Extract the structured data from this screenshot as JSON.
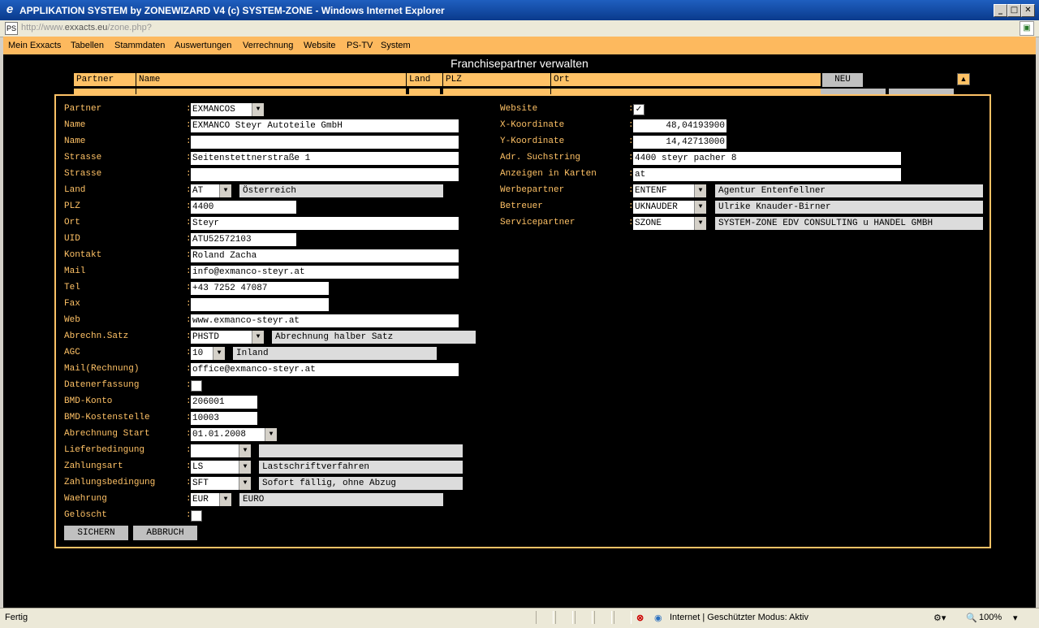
{
  "window": {
    "title": "APPLIKATION SYSTEM by ZONEWIZARD V4 (c) SYSTEM-ZONE - Windows Internet Explorer",
    "url_prefix": "http://www.",
    "url_domain": "exxacts.eu",
    "url_path": "/zone.php?"
  },
  "menu": [
    "Mein Exxacts",
    "Tabellen",
    "Stammdaten",
    "Auswertungen",
    "Verrechnung",
    "Website",
    "PS-TV",
    "System"
  ],
  "page_title": "Franchisepartner verwalten",
  "list_header": {
    "partner": "Partner",
    "name": "Name",
    "land": "Land",
    "plz": "PLZ",
    "ort": "Ort",
    "new_button": "NEU"
  },
  "form_left": {
    "partner": {
      "label": "Partner",
      "value": "EXMANCOS"
    },
    "name1": {
      "label": "Name",
      "value": "EXMANCO Steyr Autoteile GmbH"
    },
    "name2": {
      "label": "Name",
      "value": ""
    },
    "strasse1": {
      "label": "Strasse",
      "value": "Seitenstettnerstraße 1"
    },
    "strasse2": {
      "label": "Strasse",
      "value": ""
    },
    "land": {
      "label": "Land",
      "value": "AT",
      "desc": "Österreich"
    },
    "plz": {
      "label": "PLZ",
      "value": "4400"
    },
    "ort": {
      "label": "Ort",
      "value": "Steyr"
    },
    "uid": {
      "label": "UID",
      "value": "ATU52572103"
    },
    "kontakt": {
      "label": "Kontakt",
      "value": "Roland Zacha"
    },
    "mail": {
      "label": "Mail",
      "value": "info@exmanco-steyr.at"
    },
    "tel": {
      "label": "Tel",
      "value": "+43 7252 47087"
    },
    "fax": {
      "label": "Fax",
      "value": ""
    },
    "web": {
      "label": "Web",
      "value": "www.exmanco-steyr.at"
    },
    "abrechn_satz": {
      "label": "Abrechn.Satz",
      "value": "PHSTD",
      "desc": "Abrechnung halber Satz"
    },
    "agc": {
      "label": "AGC",
      "value": "10",
      "desc": "Inland"
    },
    "mail_rechnung": {
      "label": "Mail(Rechnung)",
      "value": "office@exmanco-steyr.at"
    },
    "datenerfassung": {
      "label": "Datenerfassung",
      "checked": false
    },
    "bmd_konto": {
      "label": "BMD-Konto",
      "value": "206001"
    },
    "bmd_kostenstelle": {
      "label": "BMD-Kostenstelle",
      "value": "10003"
    },
    "abrechnung_start": {
      "label": "Abrechnung Start",
      "value": "01.01.2008"
    },
    "lieferbedingung": {
      "label": "Lieferbedingung",
      "value": "",
      "desc": ""
    },
    "zahlungsart": {
      "label": "Zahlungsart",
      "value": "LS",
      "desc": "Lastschriftverfahren"
    },
    "zahlungsbedingung": {
      "label": "Zahlungsbedingung",
      "value": "SFT",
      "desc": "Sofort fällig, ohne Abzug"
    },
    "waehrung": {
      "label": "Waehrung",
      "value": "EUR",
      "desc": "EURO"
    },
    "geloescht": {
      "label": "Gelöscht",
      "checked": false
    }
  },
  "form_right": {
    "website": {
      "label": "Website",
      "checked": true
    },
    "x_koordinate": {
      "label": "X-Koordinate",
      "value": "48,04193900"
    },
    "y_koordinate": {
      "label": "Y-Koordinate",
      "value": "14,42713000"
    },
    "adr_suchstring": {
      "label": "Adr. Suchstring",
      "value": "4400 steyr pacher 8"
    },
    "anzeigen_in_karten": {
      "label": "Anzeigen in Karten",
      "value": "at"
    },
    "werbepartner": {
      "label": "Werbepartner",
      "value": "ENTENF",
      "desc": "Agentur Entenfellner"
    },
    "betreuer": {
      "label": "Betreuer",
      "value": "UKNAUDER",
      "desc": "Ulrike Knauder-Birner"
    },
    "servicepartner": {
      "label": "Servicepartner",
      "value": "SZONE",
      "desc": "SYSTEM-ZONE EDV CONSULTING u HANDEL GMBH"
    }
  },
  "buttons": {
    "save": "SICHERN",
    "cancel": "ABBRUCH"
  },
  "checkmark": "✓",
  "status": {
    "left": "Fertig",
    "zone": "Internet | Geschützter Modus: Aktiv",
    "zoom": "100%"
  },
  "colors": {
    "accent": "#ffc266",
    "menubar": "#fdb95e",
    "background": "#000000",
    "readonly": "#dcdcdc"
  }
}
